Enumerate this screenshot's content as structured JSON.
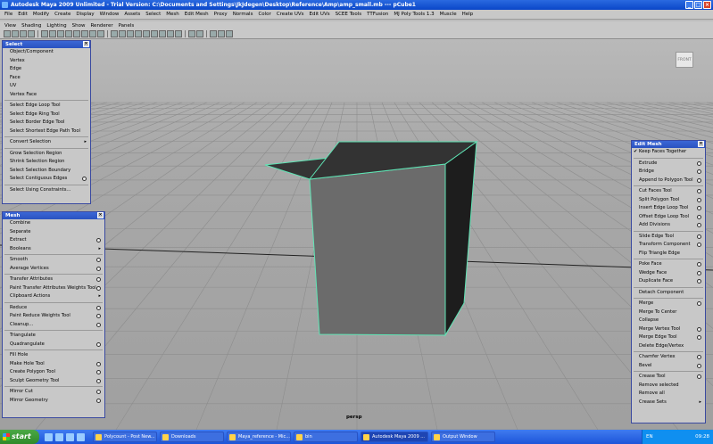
{
  "window": {
    "title": "Autodesk Maya 2009 Unlimited - Trial Version: C:\\Documents and Settings\\JkJdegen\\Desktop\\Reference\\Amp\\amp_small.mb  ---  pCube1"
  },
  "menubar": [
    "File",
    "Edit",
    "Modify",
    "Create",
    "Display",
    "Window",
    "Assets",
    "Select",
    "Mesh",
    "Edit Mesh",
    "Proxy",
    "Normals",
    "Color",
    "Create UVs",
    "Edit UVs",
    "SCEE Tools",
    "TTFusion",
    "MJ Poly Tools 1.3",
    "Muscle",
    "Help"
  ],
  "panel_menu": [
    "View",
    "Shading",
    "Lighting",
    "Show",
    "Renderer",
    "Panels"
  ],
  "viewport": {
    "camera_label": "persp",
    "viewcube_label": "FRONT"
  },
  "select_panel": {
    "title": "Select",
    "items": [
      {
        "label": "Object/Component"
      },
      {
        "label": "Vertex"
      },
      {
        "label": "Edge"
      },
      {
        "label": "Face"
      },
      {
        "label": "UV"
      },
      {
        "label": "Vertex Face"
      },
      {
        "sep": true
      },
      {
        "label": "Select Edge Loop Tool"
      },
      {
        "label": "Select Edge Ring Tool"
      },
      {
        "label": "Select Border Edge Tool"
      },
      {
        "label": "Select Shortest Edge Path Tool"
      },
      {
        "sep": true
      },
      {
        "label": "Convert Selection",
        "arrow": true
      },
      {
        "sep": true
      },
      {
        "label": "Grow Selection Region"
      },
      {
        "label": "Shrink Selection Region"
      },
      {
        "label": "Select Selection Boundary"
      },
      {
        "label": "Select Contiguous Edges",
        "opt": true
      },
      {
        "sep": true
      },
      {
        "label": "Select Using Constraints..."
      }
    ]
  },
  "mesh_panel": {
    "title": "Mesh",
    "items": [
      {
        "label": "Combine"
      },
      {
        "label": "Separate"
      },
      {
        "label": "Extract",
        "opt": true
      },
      {
        "label": "Booleans",
        "arrow": true
      },
      {
        "sep": true
      },
      {
        "label": "Smooth",
        "opt": true
      },
      {
        "label": "Average Vertices",
        "opt": true
      },
      {
        "sep": true
      },
      {
        "label": "Transfer Attributes",
        "opt": true
      },
      {
        "label": "Paint Transfer Attributes Weights Tool",
        "opt": true
      },
      {
        "label": "Clipboard Actions",
        "arrow": true
      },
      {
        "sep": true
      },
      {
        "label": "Reduce",
        "opt": true
      },
      {
        "label": "Paint Reduce Weights Tool",
        "opt": true
      },
      {
        "label": "Cleanup...",
        "opt": true
      },
      {
        "sep": true
      },
      {
        "label": "Triangulate"
      },
      {
        "label": "Quadrangulate",
        "opt": true
      },
      {
        "sep": true
      },
      {
        "label": "Fill Hole"
      },
      {
        "label": "Make Hole Tool",
        "opt": true
      },
      {
        "label": "Create Polygon Tool",
        "opt": true
      },
      {
        "label": "Sculpt Geometry Tool",
        "opt": true
      },
      {
        "sep": true
      },
      {
        "label": "Mirror Cut",
        "opt": true
      },
      {
        "label": "Mirror Geometry",
        "opt": true
      }
    ]
  },
  "editmesh_panel": {
    "title": "Edit Mesh",
    "items": [
      {
        "label": "Keep Faces Together",
        "check": true
      },
      {
        "sep": true
      },
      {
        "label": "Extrude",
        "opt": true
      },
      {
        "label": "Bridge",
        "opt": true
      },
      {
        "label": "Append to Polygon Tool",
        "opt": true
      },
      {
        "sep": true
      },
      {
        "label": "Cut Faces Tool",
        "opt": true
      },
      {
        "label": "Split Polygon Tool",
        "opt": true
      },
      {
        "label": "Insert Edge Loop Tool",
        "opt": true
      },
      {
        "label": "Offset Edge Loop Tool",
        "opt": true
      },
      {
        "label": "Add Divisions",
        "opt": true
      },
      {
        "sep": true
      },
      {
        "label": "Slide Edge Tool",
        "opt": true
      },
      {
        "label": "Transform Component",
        "opt": true
      },
      {
        "label": "Flip Triangle Edge"
      },
      {
        "sep": true
      },
      {
        "label": "Poke Face",
        "opt": true
      },
      {
        "label": "Wedge Face",
        "opt": true
      },
      {
        "label": "Duplicate Face",
        "opt": true
      },
      {
        "sep": true
      },
      {
        "label": "Detach Component"
      },
      {
        "sep": true
      },
      {
        "label": "Merge",
        "opt": true
      },
      {
        "label": "Merge To Center"
      },
      {
        "label": "Collapse"
      },
      {
        "label": "Merge Vertex Tool",
        "opt": true
      },
      {
        "label": "Merge Edge Tool",
        "opt": true
      },
      {
        "label": "Delete Edge/Vertex"
      },
      {
        "sep": true
      },
      {
        "label": "Chamfer Vertex",
        "opt": true
      },
      {
        "label": "Bevel",
        "opt": true
      },
      {
        "sep": true
      },
      {
        "label": "Crease Tool",
        "opt": true
      },
      {
        "label": "Remove selected"
      },
      {
        "label": "Remove all"
      },
      {
        "label": "Crease Sets",
        "arrow": true
      }
    ]
  },
  "taskbar": {
    "start_label": "start",
    "tasks": [
      {
        "label": "Polycount - Post New..."
      },
      {
        "label": "Downloads"
      },
      {
        "label": "Maya_reference - Mic..."
      },
      {
        "label": "bin"
      },
      {
        "label": "Autodesk Maya 2009 ...",
        "active": true
      },
      {
        "label": "Output Window"
      }
    ],
    "lang": "EN",
    "time": "09:28"
  },
  "colors": {
    "titlebar": "#0a46c8",
    "cube_edge": "#4fe0b0",
    "panel_header": "#2a52c0"
  }
}
